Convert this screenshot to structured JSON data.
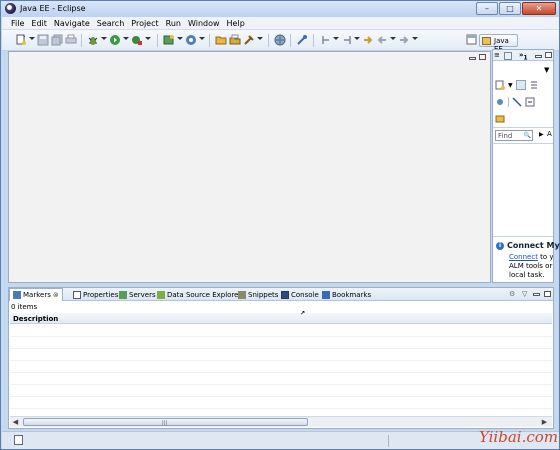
{
  "window": {
    "title": "Java EE - Eclipse",
    "controls": [
      "minimize",
      "maximize",
      "close"
    ]
  },
  "menu": [
    "File",
    "Edit",
    "Navigate",
    "Search",
    "Project",
    "Run",
    "Window",
    "Help"
  ],
  "toolbar": {
    "perspective_label": "Java EE"
  },
  "right_panel": {
    "tab_count": "1",
    "tab_overflow": "»",
    "find_placeholder": "Find",
    "filter_label": "A",
    "connect_title": "Connect My",
    "connect_link": "Connect",
    "connect_line1_rest": " to yo",
    "connect_line2": "ALM tools or",
    "connect_line3": "local task."
  },
  "bottom_panel": {
    "tabs": [
      "Markers",
      "Properties",
      "Servers",
      "Data Source Explorer",
      "Snippets",
      "Console",
      "Bookmarks"
    ],
    "active_tab": "Markers",
    "items_count": "0 items",
    "column_header": "Description"
  },
  "watermark": "Yiibai.com"
}
